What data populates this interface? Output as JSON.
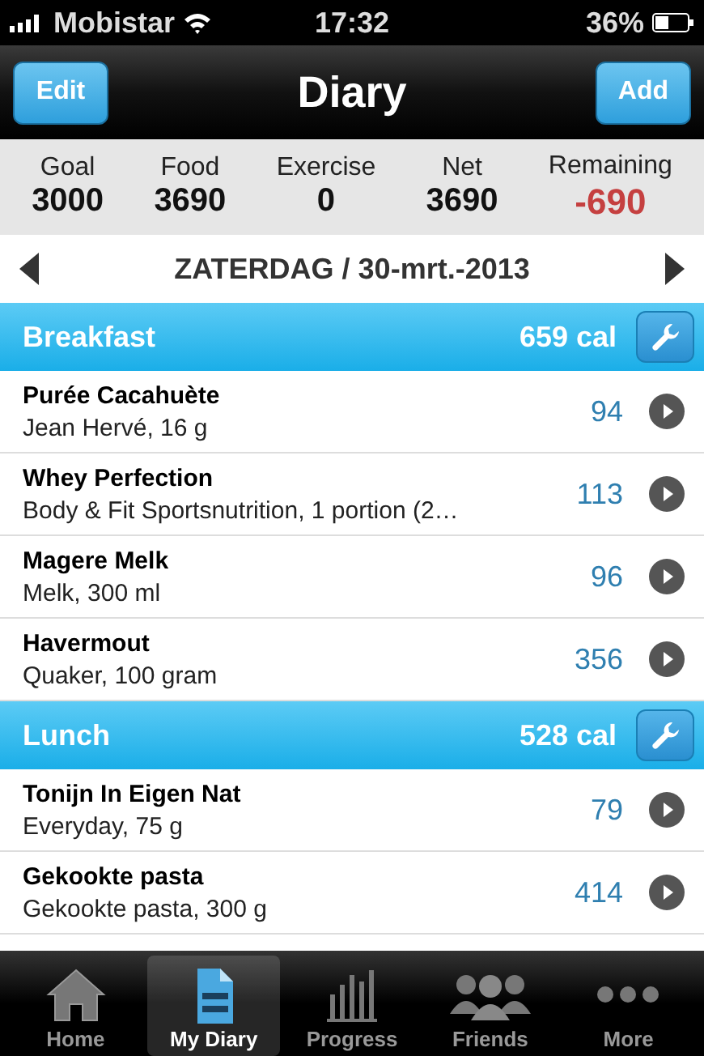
{
  "status_bar": {
    "carrier": "Mobistar",
    "time": "17:32",
    "battery": "36%"
  },
  "nav_bar": {
    "title": "Diary",
    "left_button": "Edit",
    "right_button": "Add"
  },
  "summary": [
    {
      "label": "Goal",
      "value": "3000",
      "negative": false
    },
    {
      "label": "Food",
      "value": "3690",
      "negative": false
    },
    {
      "label": "Exercise",
      "value": "0",
      "negative": false
    },
    {
      "label": "Net",
      "value": "3690",
      "negative": false
    },
    {
      "label": "Remaining",
      "value": "-690",
      "negative": true
    }
  ],
  "date_bar": {
    "date": "ZATERDAG / 30-mrt.-2013"
  },
  "meals": [
    {
      "name": "Breakfast",
      "calories": "659 cal",
      "entries": [
        {
          "name": "Purée Cacahuète",
          "detail": "Jean Hervé, 16 g",
          "calories": "94"
        },
        {
          "name": "Whey Perfection",
          "detail": "Body & Fit Sportsnutrition, 1 portion (2…",
          "calories": "113"
        },
        {
          "name": "Magere Melk",
          "detail": "Melk, 300 ml",
          "calories": "96"
        },
        {
          "name": "Havermout",
          "detail": "Quaker, 100 gram",
          "calories": "356"
        }
      ]
    },
    {
      "name": "Lunch",
      "calories": "528 cal",
      "entries": [
        {
          "name": "Tonijn In Eigen Nat",
          "detail": "Everyday, 75 g",
          "calories": "79"
        },
        {
          "name": "Gekookte pasta",
          "detail": "Gekookte pasta, 300 g",
          "calories": "414"
        }
      ]
    }
  ],
  "tab_bar": [
    {
      "kind": "home",
      "label": "Home",
      "selected": false
    },
    {
      "kind": "diary",
      "label": "My Diary",
      "selected": true
    },
    {
      "kind": "progress",
      "label": "Progress",
      "selected": false
    },
    {
      "kind": "friends",
      "label": "Friends",
      "selected": false
    },
    {
      "kind": "more",
      "label": "More",
      "selected": false
    }
  ]
}
